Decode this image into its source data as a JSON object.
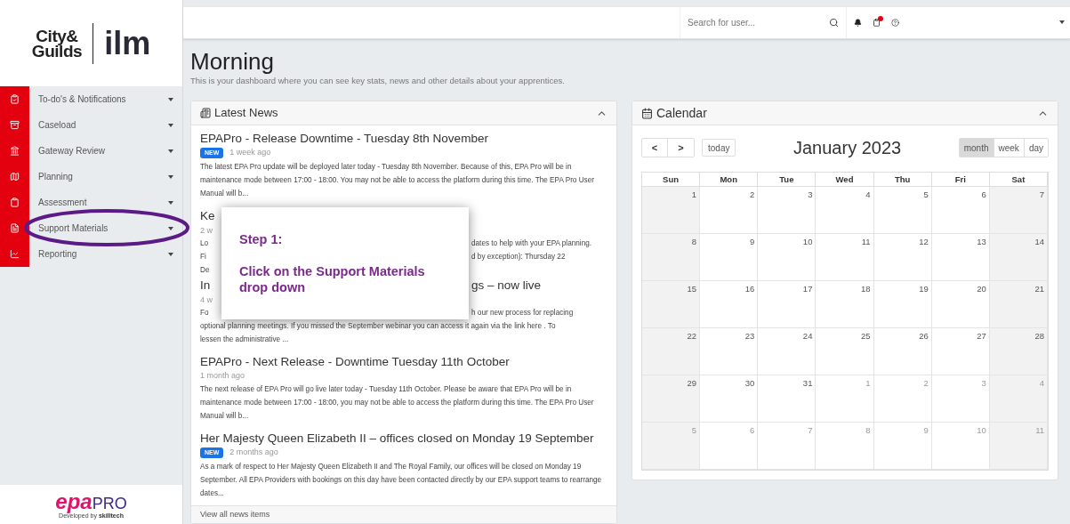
{
  "sidebar": {
    "logo": {
      "brand_line1": "City&",
      "brand_line2": "Guilds",
      "brand_partner": "ilm"
    },
    "items": [
      {
        "label": "To-do's & Notifications",
        "highlighted": false
      },
      {
        "label": "Caseload",
        "highlighted": false
      },
      {
        "label": "Gateway Review",
        "highlighted": false
      },
      {
        "label": "Planning",
        "highlighted": false
      },
      {
        "label": "Assessment",
        "highlighted": false
      },
      {
        "label": "Support Materials",
        "highlighted": true
      },
      {
        "label": "Reporting",
        "highlighted": false
      }
    ],
    "footer_logo": {
      "part1": "epa",
      "part2": "PRO",
      "credit": "Developed by",
      "credit_brand": "skilltech"
    }
  },
  "top_bar": {
    "search": {
      "placeholder": "Search for user..."
    },
    "notification_dot": true
  },
  "page": {
    "title": "Morning",
    "subtitle": "This is your dashboard where you can see key stats, news and other details about your apprentices."
  },
  "news": {
    "title": "Latest News",
    "expanded": true,
    "items_before": [
      {
        "title": "EPAPro - Release Downtime - Tuesday 8th November",
        "is_new": true,
        "badge": "NEW",
        "age": "1 week ago",
        "body": "The latest EPA Pro update will be deployed later today - Tuesday 8th November. Because of this, EPA Pro will be in maintenance mode between 17:00 - 18:00. You may not be able to access the platform during this time.  The EPA Pro User Manual will b..."
      }
    ],
    "covered_lines": [
      {
        "kind": "title",
        "left": "Ke"
      },
      {
        "kind": "meta",
        "left": "2 w"
      },
      {
        "kind": "body",
        "left": "Lo",
        "right": "dates to help with your EPA planning."
      },
      {
        "kind": "body",
        "left": "Fi",
        "right": "d by exception):  Thursday 22"
      },
      {
        "kind": "body",
        "left": "De"
      },
      {
        "kind": "title",
        "left": "In",
        "right": "gs – now live"
      },
      {
        "kind": "meta",
        "left": "4 w"
      },
      {
        "kind": "body",
        "left": "Fo",
        "right": "h our new process for replacing"
      }
    ],
    "after_cover": [
      "optional planning meetings. If you missed the September webinar you can access it again via the link here .  To",
      "lessen the administrative ..."
    ],
    "items_after": [
      {
        "title": "EPAPro - Next Release - Downtime Tuesday 11th October",
        "is_new": false,
        "age": "1 month ago",
        "body": "The next release of EPA Pro will go live later today - Tuesday 11th October. Please be aware that EPA Pro will be in maintenance mode between 17:00 - 18:00, you may not be able to access the platform during this time. The EPA Pro User Manual will b..."
      },
      {
        "title": "Her Majesty Queen Elizabeth II – offices closed on Monday 19 September",
        "is_new": true,
        "badge": "NEW",
        "age": "2 months ago",
        "body": "As a mark of respect to Her Majesty Queen Elizabeth II and The Royal Family, our offices will be closed on Monday 19 September. All EPA Providers with bookings on this day have been contacted directly by our EPA support teams to rearrange dates..."
      }
    ],
    "footer_link": "View all news items"
  },
  "annotation": {
    "step": "Step 1:",
    "text": "Click on the Support Materials drop down"
  },
  "calendar": {
    "title": "Calendar",
    "expanded": true,
    "prev": "<",
    "next": ">",
    "today": "today",
    "month_title": "January 2023",
    "views": [
      {
        "label": "month",
        "selected": true
      },
      {
        "label": "week",
        "selected": false
      },
      {
        "label": "day",
        "selected": false
      }
    ],
    "weekdays": [
      "Sun",
      "Mon",
      "Tue",
      "Wed",
      "Thu",
      "Fri",
      "Sat"
    ],
    "weeks": [
      [
        {
          "day": "1",
          "faded": false
        },
        {
          "day": "2",
          "faded": false
        },
        {
          "day": "3",
          "faded": false
        },
        {
          "day": "4",
          "faded": false
        },
        {
          "day": "5",
          "faded": false
        },
        {
          "day": "6",
          "faded": false
        },
        {
          "day": "7",
          "faded": false
        }
      ],
      [
        {
          "day": "8",
          "faded": false
        },
        {
          "day": "9",
          "faded": false
        },
        {
          "day": "10",
          "faded": false
        },
        {
          "day": "11",
          "faded": false
        },
        {
          "day": "12",
          "faded": false
        },
        {
          "day": "13",
          "faded": false
        },
        {
          "day": "14",
          "faded": false
        }
      ],
      [
        {
          "day": "15",
          "faded": false
        },
        {
          "day": "16",
          "faded": false
        },
        {
          "day": "17",
          "faded": false
        },
        {
          "day": "18",
          "faded": false
        },
        {
          "day": "19",
          "faded": false
        },
        {
          "day": "20",
          "faded": false
        },
        {
          "day": "21",
          "faded": false
        }
      ],
      [
        {
          "day": "22",
          "faded": false
        },
        {
          "day": "23",
          "faded": false
        },
        {
          "day": "24",
          "faded": false
        },
        {
          "day": "25",
          "faded": false
        },
        {
          "day": "26",
          "faded": false
        },
        {
          "day": "27",
          "faded": false
        },
        {
          "day": "28",
          "faded": false
        }
      ],
      [
        {
          "day": "29",
          "faded": false
        },
        {
          "day": "30",
          "faded": false
        },
        {
          "day": "31",
          "faded": false
        },
        {
          "day": "1",
          "faded": true
        },
        {
          "day": "2",
          "faded": true
        },
        {
          "day": "3",
          "faded": true
        },
        {
          "day": "4",
          "faded": true
        }
      ],
      [
        {
          "day": "5",
          "faded": true
        },
        {
          "day": "6",
          "faded": true
        },
        {
          "day": "7",
          "faded": true
        },
        {
          "day": "8",
          "faded": true
        },
        {
          "day": "9",
          "faded": true
        },
        {
          "day": "10",
          "faded": true
        },
        {
          "day": "11",
          "faded": true
        }
      ]
    ]
  }
}
